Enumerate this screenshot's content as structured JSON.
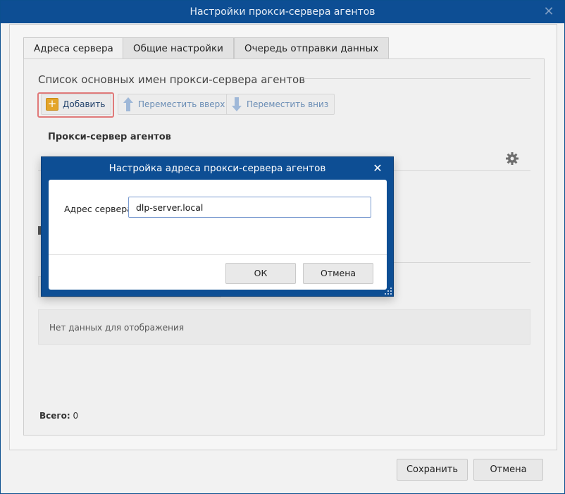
{
  "window": {
    "title": "Настройки прокси-сервера агентов",
    "close_icon": "close-icon"
  },
  "tabs": [
    {
      "label": "Адреса сервера",
      "active": true
    },
    {
      "label": "Общие настройки",
      "active": false
    },
    {
      "label": "Очередь отправки данных",
      "active": false
    }
  ],
  "section": {
    "title": "Список основных имен прокси-сервера агентов"
  },
  "toolbar": {
    "add_label": "Добавить",
    "move_up_label": "Переместить вверх",
    "move_down_label": "Переместить вниз"
  },
  "table": {
    "column_header": "Прокси-сервер агентов",
    "settings_icon": "gear-icon"
  },
  "empty_list": {
    "text": "Нет данных для отображения"
  },
  "totals": {
    "label": "Всего:",
    "value": "0"
  },
  "footer": {
    "save_label": "Сохранить",
    "cancel_label": "Отмена"
  },
  "modal": {
    "title": "Настройка адреса прокси-сервера агентов",
    "field_label": "Адрес сервера:",
    "field_value": "dlp-server.local",
    "ok_label": "ОК",
    "cancel_label": "Отмена"
  },
  "colors": {
    "titlebar": "#0d4e94",
    "add_icon": "#e4a52a",
    "highlight": "#e07a7a"
  }
}
